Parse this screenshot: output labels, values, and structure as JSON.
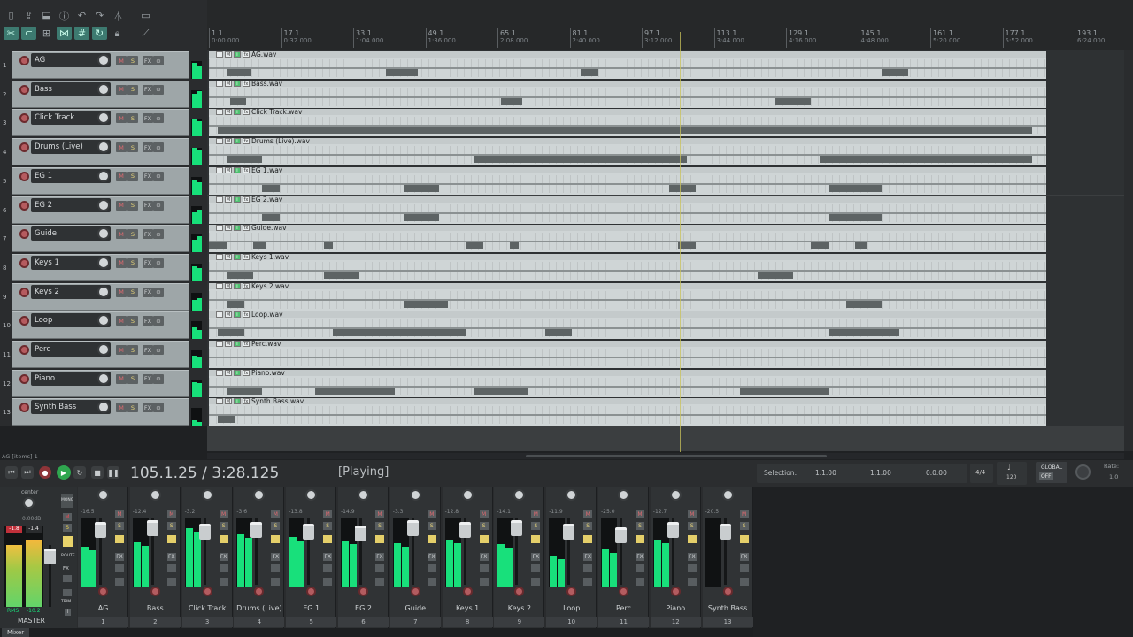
{
  "ruler": {
    "marks": [
      {
        "m": "1.1",
        "t": "0:00.000"
      },
      {
        "m": "17.1",
        "t": "0:32.000"
      },
      {
        "m": "33.1",
        "t": "1:04.000"
      },
      {
        "m": "49.1",
        "t": "1:36.000"
      },
      {
        "m": "65.1",
        "t": "2:08.000"
      },
      {
        "m": "81.1",
        "t": "2:40.000"
      },
      {
        "m": "97.1",
        "t": "3:12.000"
      },
      {
        "m": "113.1",
        "t": "3:44.000"
      },
      {
        "m": "129.1",
        "t": "4:16.000"
      },
      {
        "m": "145.1",
        "t": "4:48.000"
      },
      {
        "m": "161.1",
        "t": "5:20.000"
      },
      {
        "m": "177.1",
        "t": "5:52.000"
      },
      {
        "m": "193.1",
        "t": "6:24.000"
      }
    ]
  },
  "tracks": [
    {
      "num": "1",
      "name": "AG",
      "file": "AG.wav"
    },
    {
      "num": "2",
      "name": "Bass",
      "file": "Bass.wav"
    },
    {
      "num": "3",
      "name": "Click Track",
      "file": "Click Track.wav"
    },
    {
      "num": "4",
      "name": "Drums (Live)",
      "file": "Drums (Live).wav"
    },
    {
      "num": "5",
      "name": "EG 1",
      "file": "EG 1.wav"
    },
    {
      "num": "6",
      "name": "EG 2",
      "file": "EG 2.wav"
    },
    {
      "num": "7",
      "name": "Guide",
      "file": "Guide.wav"
    },
    {
      "num": "8",
      "name": "Keys 1",
      "file": "Keys 1.wav"
    },
    {
      "num": "9",
      "name": "Keys 2",
      "file": "Keys 2.wav"
    },
    {
      "num": "10",
      "name": "Loop",
      "file": "Loop.wav"
    },
    {
      "num": "11",
      "name": "Perc",
      "file": "Perc.wav"
    },
    {
      "num": "12",
      "name": "Piano",
      "file": "Piano.wav"
    },
    {
      "num": "13",
      "name": "Synth Bass",
      "file": "Synth Bass.wav"
    }
  ],
  "track_buttons": {
    "mute": "M",
    "solo": "S",
    "fx": "FX",
    "io": "⊙"
  },
  "status_left": "AG [items] 1",
  "transport": {
    "time": "105.1.25 / 3:28.125",
    "state": "[Playing]"
  },
  "selection": {
    "label": "Selection:",
    "start": "1.1.00",
    "end": "1.1.00",
    "length": "0.0.00",
    "timesig": "4/4",
    "bpm": "120",
    "global": "GLOBAL",
    "global_state": "OFF",
    "rate_label": "Rate:",
    "rate": "1.0"
  },
  "master": {
    "pan": "center",
    "db": "0.00dB",
    "peak_l": "-1.8",
    "peak_r": "-1.4",
    "rms_label": "RMS",
    "rms": "-10.2",
    "name": "MASTER",
    "buttons": [
      "MONO",
      "M",
      "S",
      "ROUTE",
      "FX",
      "TRIM"
    ]
  },
  "mixer": [
    {
      "name": "AG",
      "no": "1",
      "db": "-16.5",
      "lvl": 0.62
    },
    {
      "name": "Bass",
      "no": "2",
      "db": "-12.4",
      "lvl": 0.7
    },
    {
      "name": "Click Track",
      "no": "3",
      "db": "-3.2",
      "lvl": 0.92
    },
    {
      "name": "Drums (Live)",
      "no": "4",
      "db": "-3.6",
      "lvl": 0.82
    },
    {
      "name": "EG 1",
      "no": "5",
      "db": "-13.8",
      "lvl": 0.78
    },
    {
      "name": "EG 2",
      "no": "6",
      "db": "-14.9",
      "lvl": 0.72
    },
    {
      "name": "Guide",
      "no": "7",
      "db": "-3.3",
      "lvl": 0.68
    },
    {
      "name": "Keys 1",
      "no": "8",
      "db": "-12.8",
      "lvl": 0.74
    },
    {
      "name": "Keys 2",
      "no": "9",
      "db": "-14.1",
      "lvl": 0.66
    },
    {
      "name": "Loop",
      "no": "10",
      "db": "-11.9",
      "lvl": 0.48
    },
    {
      "name": "Perc",
      "no": "11",
      "db": "-25.0",
      "lvl": 0.58
    },
    {
      "name": "Piano",
      "no": "12",
      "db": "-12.7",
      "lvl": 0.74
    },
    {
      "name": "Synth Bass",
      "no": "13",
      "db": "-20.5",
      "lvl": 0.0
    }
  ],
  "bottom_tab": "Mixer"
}
